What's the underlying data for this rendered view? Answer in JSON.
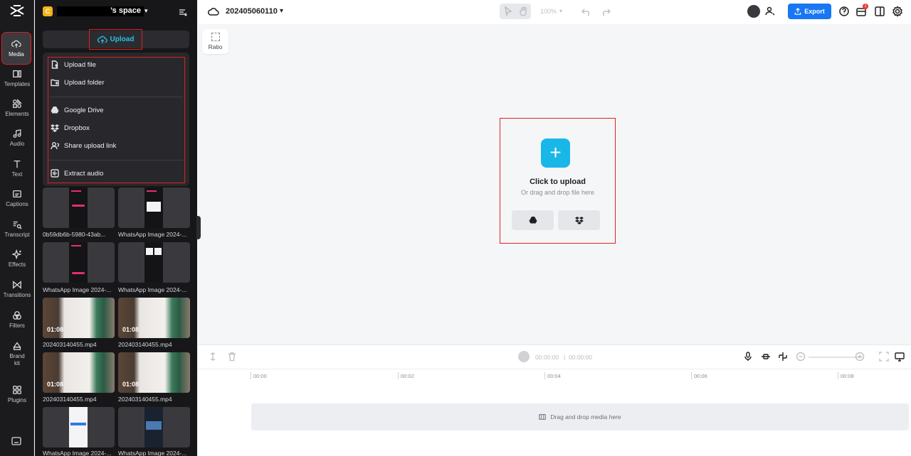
{
  "rail": {
    "items": [
      {
        "label": "Media",
        "icon": "cloud-upload-icon"
      },
      {
        "label": "Templates",
        "icon": "templates-icon"
      },
      {
        "label": "Elements",
        "icon": "elements-icon"
      },
      {
        "label": "Audio",
        "icon": "music-note-icon"
      },
      {
        "label": "Text",
        "icon": "text-icon"
      },
      {
        "label": "Captions",
        "icon": "captions-icon"
      },
      {
        "label": "Transcript",
        "icon": "transcript-icon"
      },
      {
        "label": "Effects",
        "icon": "sparkle-icon"
      },
      {
        "label": "Transitions",
        "icon": "transitions-icon"
      },
      {
        "label": "Filters",
        "icon": "filters-icon"
      },
      {
        "label": "Brand kit",
        "icon": "brand-kit-icon"
      },
      {
        "label": "Plugins",
        "icon": "plugins-icon"
      }
    ]
  },
  "panel": {
    "space_badge": "C",
    "space_name": "’s space",
    "upload_label": "Upload",
    "menu": [
      {
        "label": "Upload file",
        "icon": "file-upload-icon"
      },
      {
        "label": "Upload folder",
        "icon": "folder-upload-icon"
      },
      {
        "label": "Google Drive",
        "icon": "google-drive-icon"
      },
      {
        "label": "Dropbox",
        "icon": "dropbox-icon"
      },
      {
        "label": "Share upload link",
        "icon": "share-link-icon"
      },
      {
        "label": "Extract audio",
        "icon": "extract-audio-icon"
      }
    ],
    "media": [
      {
        "label": "0b59db6b-5980-43ab...",
        "kind": "phone"
      },
      {
        "label": "WhatsApp Image 2024-...",
        "kind": "phone-light"
      },
      {
        "label": "WhatsApp Image 2024-...",
        "kind": "phone"
      },
      {
        "label": "WhatsApp Image 2024-...",
        "kind": "phone-light"
      },
      {
        "label": "202403140455.mp4",
        "kind": "video",
        "duration": "01:08"
      },
      {
        "label": "202403140455.mp4",
        "kind": "video",
        "duration": "01:08"
      },
      {
        "label": "202403140455.mp4",
        "kind": "video",
        "duration": "01:08"
      },
      {
        "label": "202403140455.mp4",
        "kind": "video",
        "duration": "01:08"
      },
      {
        "label": "WhatsApp Image 2024-...",
        "kind": "phone-white"
      },
      {
        "label": "WhatsApp Image 2024-...",
        "kind": "phone-dark"
      }
    ]
  },
  "header": {
    "project_title": "202405060110",
    "zoom": "100%",
    "export_label": "Export",
    "notification_count": "1"
  },
  "canvas": {
    "ratio_label": "Ratio",
    "upload_title": "Click to upload",
    "upload_subtitle": "Or drag and drop file here"
  },
  "timeline": {
    "current_time": "00:00:00",
    "total_time": "00:00:00",
    "ruler": [
      "00:00",
      "00:02",
      "00:04",
      "00:06",
      "00:08"
    ],
    "drop_hint": "Drag and drop media here"
  },
  "colors": {
    "accent": "#18b7e8",
    "export": "#1877f2",
    "highlight": "#e02020"
  }
}
